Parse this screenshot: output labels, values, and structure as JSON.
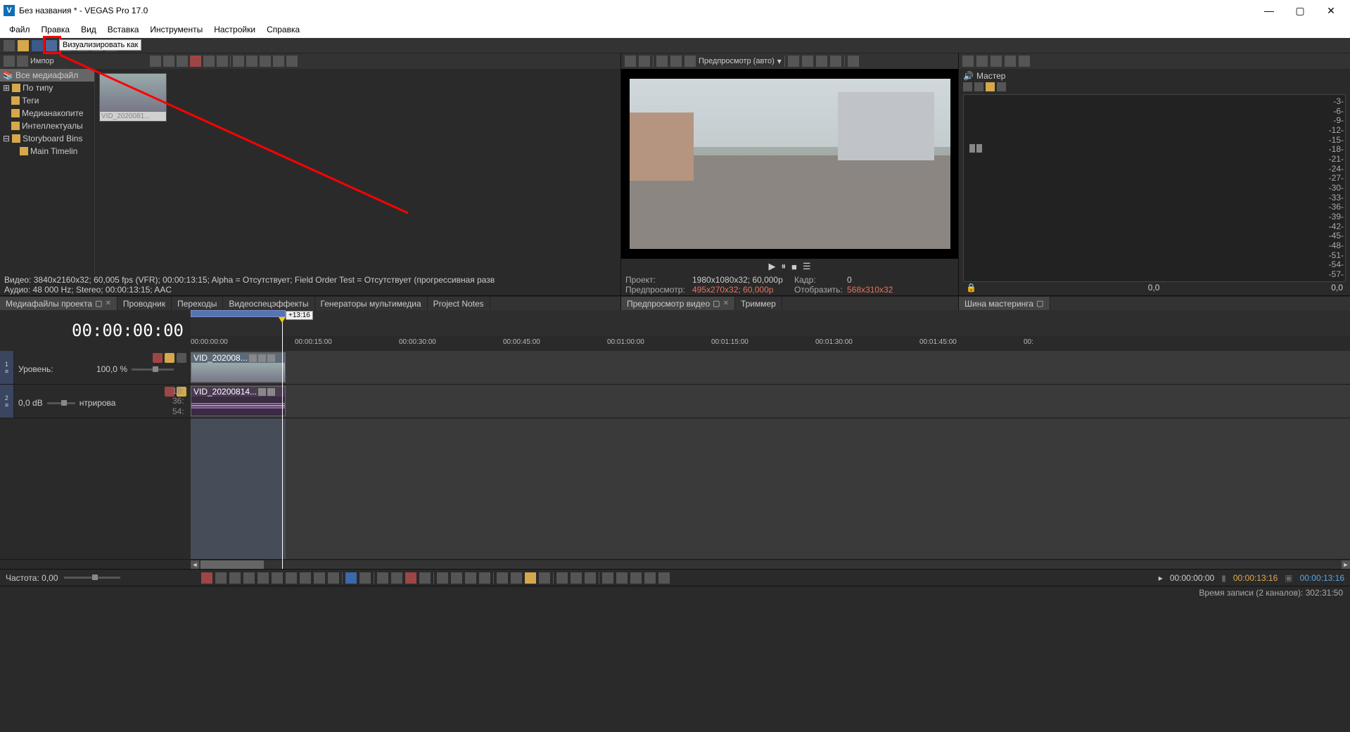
{
  "titlebar": {
    "title": "Без названия * - VEGAS Pro 17.0"
  },
  "menu": [
    "Файл",
    "Правка",
    "Вид",
    "Вставка",
    "Инструменты",
    "Настройки",
    "Справка"
  ],
  "tooltip_render": "Визуализировать как",
  "media": {
    "import_label": "Импор",
    "tree": [
      "Все медиафайл",
      "По типу",
      "Теги",
      "Медианакопите",
      "Интеллектуалы",
      "Storyboard Bins",
      "Main Timelin"
    ],
    "thumb_label": "VID_2020081...",
    "info_video": "Видео: 3840x2160x32; 60,005 fps (VFR); 00:00:13:15; Alpha = Отсутствует; Field Order Test = Отсутствует (прогрессивная разв",
    "info_audio": "Аудио: 48 000 Hz; Stereo; 00:00:13:15; AAC"
  },
  "preview": {
    "dropdown": "Предпросмотр (авто)",
    "info": {
      "proj_lbl": "Проект:",
      "proj_val": "1980x1080x32; 60,000p",
      "frame_lbl": "Кадр:",
      "frame_val": "0",
      "prev_lbl": "Предпросмотр:",
      "prev_val": "495x270x32; 60,000p",
      "disp_lbl": "Отобразить:",
      "disp_val": "568x310x32"
    }
  },
  "master": {
    "title": "Мастер",
    "marks": [
      "3",
      "6",
      "9",
      "12",
      "15",
      "18",
      "21",
      "24",
      "27",
      "30",
      "33",
      "36",
      "39",
      "42",
      "45",
      "48",
      "51",
      "54",
      "57"
    ],
    "left": "0,0",
    "right": "0,0"
  },
  "tabs": {
    "media": "Медиафайлы проекта",
    "explorer": "Проводник",
    "trans": "Переходы",
    "fx": "Видеоспецэффекты",
    "gen": "Генераторы мультимедиа",
    "notes": "Project Notes",
    "preview": "Предпросмотр видео",
    "trimmer": "Триммер",
    "mastering": "Шина мастеринга"
  },
  "timeline": {
    "maintc": "00:00:00:00",
    "tip": "+13:16",
    "marks": [
      "00:00:00:00",
      "00:00:15:00",
      "00:00:30:00",
      "00:00:45:00",
      "00:01:00:00",
      "00:01:15:00",
      "00:01:30:00",
      "00:01:45:00",
      "00:"
    ],
    "track1": {
      "level_lbl": "Уровень:",
      "level_val": "100,0 %"
    },
    "track2": {
      "db": "0,0 dB",
      "center": "нтрирова",
      "meters": [
        "18:",
        "36:",
        "54:"
      ]
    },
    "clip_v_name": "VID_202008...",
    "clip_a_name": "VID_20200814..."
  },
  "bottom": {
    "freq_lbl": "Частота: 0,00",
    "tc1": "00:00:00:00",
    "tc2": "00:00:13:16",
    "tc3": "00:00:13:16"
  },
  "status": "Время записи (2 каналов): 302:31:50"
}
